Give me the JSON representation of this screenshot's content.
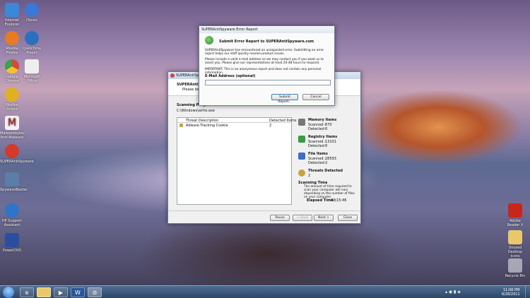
{
  "desktop": {
    "left_icons": [
      "Internet Explorer",
      "iTunes",
      "Mozilla Firefox",
      "QuickTime Player",
      "Google Chrome",
      "Microsoft Office",
      "iSkyNet Shield",
      "Malwarebytes' Anti-Malware",
      "SUPERAntiSpyware",
      "SpywareBlaster",
      "HP Support Assistant",
      "PowerDVD"
    ],
    "right_icons": [
      "Adobe Reader X",
      "Unused Desktop Icons",
      "Recycle Bin"
    ]
  },
  "main": {
    "title": "SUPERAntiSpyware",
    "heading": "SUPERAntiSpy",
    "subheading": "Please be pa",
    "scan_label": "Scanning Prog",
    "path": "C:\\Windows\\write.exe",
    "table": {
      "col1": "Threat Description",
      "col2": "Detected Items",
      "rows": [
        {
          "desc": "Adware.Tracking Cookie",
          "count": "2"
        }
      ]
    },
    "stats": [
      {
        "title": "Memory Items",
        "scanned_label": "Scanned :",
        "scanned": "670",
        "detected_label": "Detected :",
        "detected": "0"
      },
      {
        "title": "Registry Items",
        "scanned_label": "Scanned :",
        "scanned": "13101",
        "detected_label": "Detected :",
        "detected": "0"
      },
      {
        "title": "File Items",
        "scanned_label": "Scanned :",
        "scanned": "28593",
        "detected_label": "Detected :",
        "detected": "2"
      }
    ],
    "threats_title": "Threats Detected",
    "threats_count": "2",
    "time_title": "Scanning Time",
    "time_text": "The amount of time required to scan your computer will vary depending on the number of files on your computer",
    "elapsed_label": "Elapsed Time :",
    "elapsed": "00:15:46",
    "buttons": {
      "pause": "Pause",
      "back": "< Back",
      "next": "Next >",
      "close": "Close"
    }
  },
  "dialog": {
    "title": "SUPERAntiSpyware Error Report",
    "heading": "Submit Error Report to SUPERAntiSpyware.com",
    "p1": "SUPERAntiSpyware has encountered an unexpected error. Submitting an error report helps our staff quickly resolve product issues.",
    "p2": "Please include a valid e-mail address so we may contact you if you want us to assist you. Please give our representatives at least 24-48 hours to respond.",
    "p3": "IMPORTANT: This is an anonymous report and does not contain any personal information.",
    "email_label": "E-Mail Address (optional)",
    "email_value": "",
    "submit": "Submit Report...",
    "cancel": "Cancel"
  },
  "taskbar": {
    "time": "11:06 PM",
    "date": "6/28/2011"
  },
  "colors": {
    "accent": "#c9463d",
    "taskbar": "#2d4565"
  }
}
